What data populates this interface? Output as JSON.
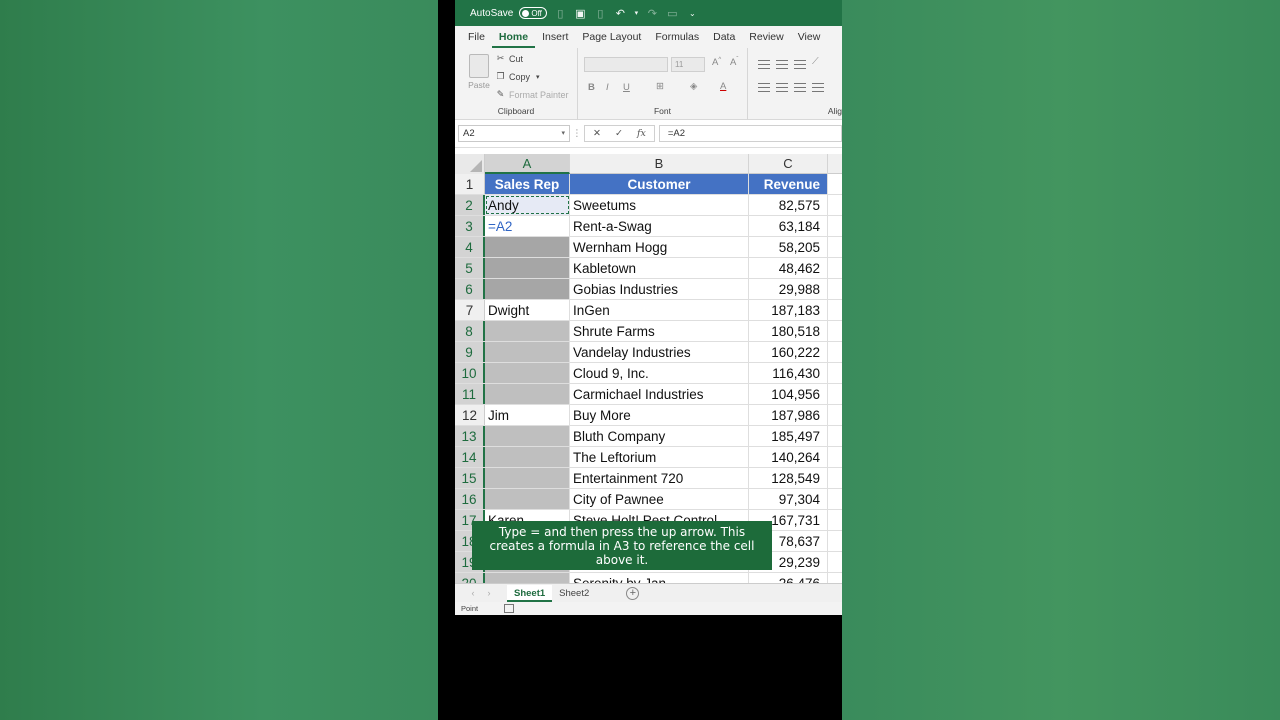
{
  "titlebar": {
    "autosave_label": "AutoSave",
    "autosave_state": "Off"
  },
  "menu": {
    "tabs": [
      "File",
      "Home",
      "Insert",
      "Page Layout",
      "Formulas",
      "Data",
      "Review",
      "View"
    ],
    "active": "Home"
  },
  "ribbon": {
    "clipboard": {
      "paste": "Paste",
      "cut": "Cut",
      "copy": "Copy",
      "format_painter": "Format Painter",
      "label": "Clipboard"
    },
    "font": {
      "size": "11",
      "label": "Font",
      "bold": "B",
      "italic": "I",
      "underline": "U"
    },
    "alignment_label": "Alig"
  },
  "formula_bar": {
    "name_box": "A2",
    "formula": "=A2",
    "fx": "fx"
  },
  "columns": [
    "A",
    "B",
    "C"
  ],
  "rows": [
    {
      "n": "1",
      "a": "Sales Rep",
      "b": "Customer",
      "c": "Revenue"
    },
    {
      "n": "2",
      "a": "Andy",
      "b": "Sweetums",
      "c": "82,575"
    },
    {
      "n": "3",
      "a": "=A2",
      "b": "Rent-a-Swag",
      "c": "63,184"
    },
    {
      "n": "4",
      "a": "",
      "b": "Wernham Hogg",
      "c": "58,205"
    },
    {
      "n": "5",
      "a": "",
      "b": "Kabletown",
      "c": "48,462"
    },
    {
      "n": "6",
      "a": "",
      "b": "Gobias Industries",
      "c": "29,988"
    },
    {
      "n": "7",
      "a": "Dwight",
      "b": "InGen",
      "c": "187,183"
    },
    {
      "n": "8",
      "a": "",
      "b": "Shrute Farms",
      "c": "180,518"
    },
    {
      "n": "9",
      "a": "",
      "b": "Vandelay Industries",
      "c": "160,222"
    },
    {
      "n": "10",
      "a": "",
      "b": "Cloud 9, Inc.",
      "c": "116,430"
    },
    {
      "n": "11",
      "a": "",
      "b": "Carmichael Industries",
      "c": "104,956"
    },
    {
      "n": "12",
      "a": "Jim",
      "b": "Buy More",
      "c": "187,986"
    },
    {
      "n": "13",
      "a": "",
      "b": "Bluth Company",
      "c": "185,497"
    },
    {
      "n": "14",
      "a": "",
      "b": "The Leftorium",
      "c": "140,264"
    },
    {
      "n": "15",
      "a": "",
      "b": "Entertainment 720",
      "c": "128,549"
    },
    {
      "n": "16",
      "a": "",
      "b": "City of Pawnee",
      "c": "97,304"
    },
    {
      "n": "17",
      "a": "Karen",
      "b": "Steve Holt! Pest Control",
      "c": "167,731"
    },
    {
      "n": "18",
      "a": "",
      "b": "",
      "c": "78,637"
    },
    {
      "n": "19",
      "a": "",
      "b": "",
      "c": "29,239"
    },
    {
      "n": "20",
      "a": "",
      "b": "Serenity by Jan",
      "c": "26,476"
    }
  ],
  "sheets": [
    "Sheet1",
    "Sheet2"
  ],
  "status": {
    "mode": "Point"
  },
  "caption": "Type = and then press the up arrow. This creates a formula in A3 to reference the cell above it."
}
